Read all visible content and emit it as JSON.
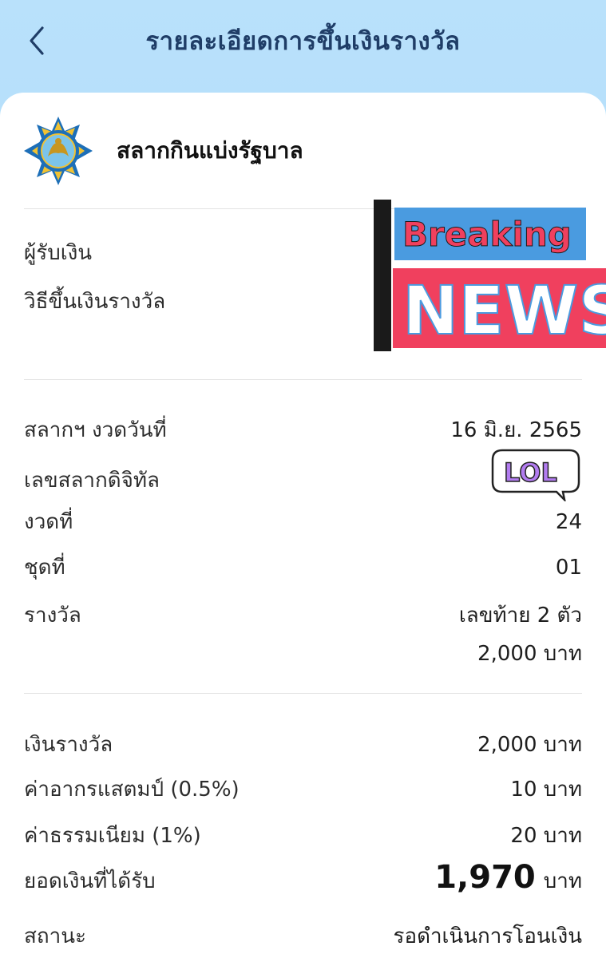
{
  "header": {
    "title": "รายละเอียดการขึ้นเงินรางวัล"
  },
  "org": {
    "name": "สลากกินแบ่งรัฐบาล"
  },
  "payee_section": {
    "payee_label": "ผู้รับเงิน",
    "method_label": "วิธีขึ้นเงินรางวัล",
    "sticker_top": "Breaking",
    "sticker_bottom": "NEWS"
  },
  "ticket": {
    "date_label": "สลากฯ งวดวันที่",
    "date_value": "16 มิ.ย. 2565",
    "number_label": "เลขสลากดิจิทัล",
    "number_sticker": "LOL",
    "draw_label": "งวดที่",
    "draw_value": "24",
    "set_label": "ชุดที่",
    "set_value": "01",
    "prize_label": "รางวัล",
    "prize_value": "เลขท้าย 2 ตัว",
    "prize_amount": "2,000 บาท"
  },
  "summary": {
    "prize_money_label": "เงินรางวัล",
    "prize_money_value": "2,000 บาท",
    "stamp_label": "ค่าอากรแสตมป์ (0.5%)",
    "stamp_value": "10 บาท",
    "fee_label": "ค่าธรรมเนียม (1%)",
    "fee_value": "20 บาท",
    "net_label": "ยอดเงินที่ได้รับ",
    "net_amount": "1,970",
    "net_unit": "บาท",
    "status_label": "สถานะ",
    "status_value": "รอดำเนินการโอนเงิน"
  },
  "colors": {
    "header_gradient_top": "#b9e1fb",
    "title": "#1f3d67",
    "status": "#e9930f",
    "sticker_blue": "#4a9be0",
    "sticker_red": "#f0405e"
  },
  "icons": {
    "back": "chevron-left-icon",
    "logo": "government-lottery-emblem-icon"
  }
}
